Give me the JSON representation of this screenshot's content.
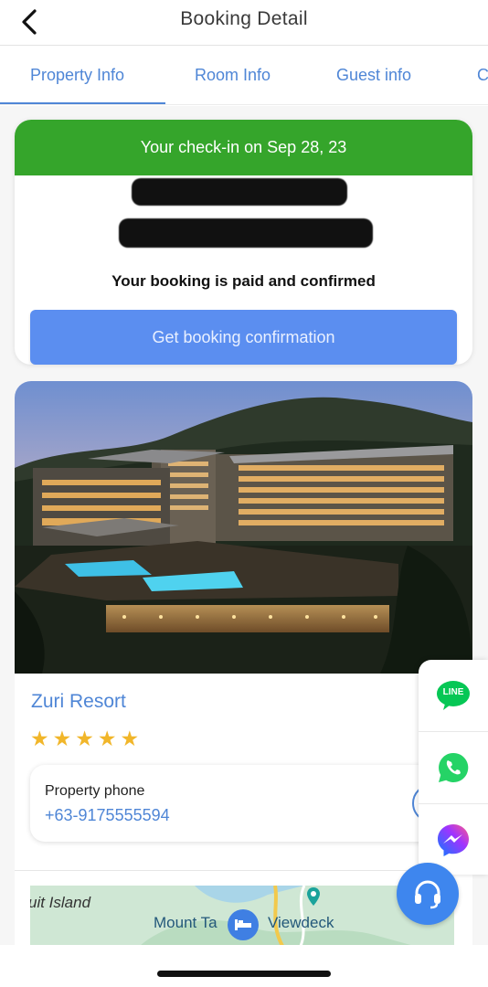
{
  "header": {
    "title": "Booking Detail"
  },
  "tabs": [
    {
      "label": "Property Info"
    },
    {
      "label": "Room Info"
    },
    {
      "label": "Guest info"
    },
    {
      "label": "C"
    }
  ],
  "booking": {
    "checkin_banner": "Your check-in on Sep 28, 23",
    "status": "Your booking is paid and confirmed",
    "confirm_button": "Get booking confirmation"
  },
  "property": {
    "name": "Zuri Resort",
    "rating_stars": 5,
    "phone_label": "Property phone",
    "phone_number": "+63-9175555594"
  },
  "map": {
    "labels": [
      "uit Island",
      "Mount Ta",
      "Viewdeck"
    ]
  },
  "chat": {
    "line_label": "LINE"
  },
  "colors": {
    "accent": "#4f86d6",
    "banner": "#35a52b",
    "button": "#5b8ef0",
    "star": "#f1b62a",
    "line": "#06c755",
    "whatsapp": "#25d366",
    "support": "#3e86ee"
  },
  "icons": [
    "back-chevron-icon",
    "phone-icon",
    "hotel-bed-icon",
    "map-pin-icon",
    "line-icon",
    "whatsapp-icon",
    "messenger-icon",
    "headset-icon"
  ]
}
